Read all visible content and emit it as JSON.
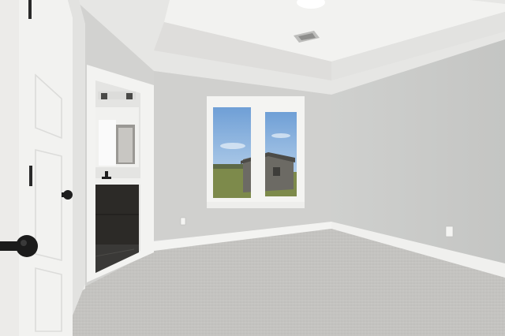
{
  "scene": {
    "type": "photo",
    "subject": "empty bedroom",
    "colors": {
      "wall_left": "#d3d3d1",
      "wall_back": "#cfcfcd",
      "wall_right": "#c9cac8",
      "ceiling": "#e9e9e7",
      "ceiling_tray": "#f1f1ef",
      "carpet": "#c3c2bf",
      "trim": "#f4f4f2",
      "door": "#f2f2f0",
      "sky": "#8fb7e0",
      "grass": "#7f8a4c",
      "vanity": "#2c2a27",
      "hardware": "#1e1e1e"
    },
    "icons": [
      "door-knob-icon",
      "door-knob-icon",
      "ceiling-vent-icon",
      "ceiling-light-icon",
      "outlet-icon"
    ]
  }
}
